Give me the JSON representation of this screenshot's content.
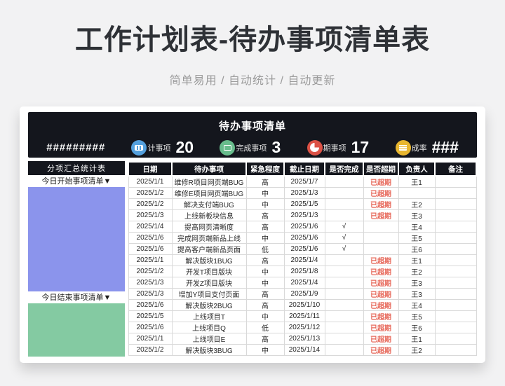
{
  "page": {
    "title": "工作计划表-待办事项清单表",
    "subtitle": "简单易用 / 自动统计 / 自动更新"
  },
  "sheet": {
    "topbar": {
      "title": "待办事项清单",
      "date_placeholder": "#########",
      "stats": [
        {
          "icon": "abacus-icon",
          "color": "#54a0dd",
          "label": "计事项",
          "value": "20"
        },
        {
          "icon": "monitor-icon",
          "color": "#68bc8c",
          "label": "完成事项",
          "value": "3"
        },
        {
          "icon": "pie-clock-icon",
          "color": "#dc5246",
          "label": "期事项",
          "value": "17"
        },
        {
          "icon": "calendar-icon",
          "color": "#e8b62f",
          "label": "成率",
          "value": "###"
        }
      ]
    },
    "sidebar": {
      "title": "分项汇总统计表",
      "sections": [
        {
          "label": "今日开始事项清单▼",
          "panel_color": "#8b94ec"
        },
        {
          "label": "今日结束事项清单▼",
          "panel_color": "#84caa2"
        }
      ]
    },
    "table": {
      "columns": [
        "日期",
        "待办事项",
        "紧急程度",
        "截止日期",
        "是否完成",
        "是否超期",
        "负责人",
        "备注"
      ],
      "rows": [
        [
          "2025/1/1",
          "维修R项目网页端BUG",
          "高",
          "2025/1/7",
          "",
          "已超期",
          "王1",
          ""
        ],
        [
          "2025/1/2",
          "维修E项目网页端BUG",
          "中",
          "2025/1/3",
          "",
          "已超期",
          "",
          ""
        ],
        [
          "2025/1/2",
          "解决支付端BUG",
          "中",
          "2025/1/5",
          "",
          "已超期",
          "王2",
          ""
        ],
        [
          "2025/1/3",
          "上线新板块信息",
          "高",
          "2025/1/3",
          "",
          "已超期",
          "王3",
          ""
        ],
        [
          "2025/1/4",
          "提高网页清晰度",
          "高",
          "2025/1/6",
          "√",
          "",
          "王4",
          ""
        ],
        [
          "2025/1/6",
          "完成网页端新品上线",
          "中",
          "2025/1/6",
          "√",
          "",
          "王5",
          ""
        ],
        [
          "2025/1/6",
          "提高客户端新品页面",
          "低",
          "2025/1/6",
          "√",
          "",
          "王6",
          ""
        ],
        [
          "2025/1/1",
          "解决版块1BUG",
          "高",
          "2025/1/4",
          "",
          "已超期",
          "王1",
          ""
        ],
        [
          "2025/1/2",
          "开发T项目版块",
          "中",
          "2025/1/8",
          "",
          "已超期",
          "王2",
          ""
        ],
        [
          "2025/1/3",
          "开发Z项目版块",
          "中",
          "2025/1/4",
          "",
          "已超期",
          "王3",
          ""
        ],
        [
          "2025/1/3",
          "增加Y项目支付页面",
          "高",
          "2025/1/9",
          "",
          "已超期",
          "王3",
          ""
        ],
        [
          "2025/1/6",
          "解决版块2BUG",
          "高",
          "2025/1/10",
          "",
          "已超期",
          "王4",
          ""
        ],
        [
          "2025/1/5",
          "上线项目T",
          "中",
          "2025/1/11",
          "",
          "已超期",
          "王5",
          ""
        ],
        [
          "2025/1/6",
          "上线项目Q",
          "低",
          "2025/1/12",
          "",
          "已超期",
          "王6",
          ""
        ],
        [
          "2025/1/1",
          "上线项目E",
          "高",
          "2025/1/13",
          "",
          "已超期",
          "王1",
          ""
        ],
        [
          "2025/1/2",
          "解决版块3BUG",
          "中",
          "2025/1/14",
          "",
          "已超期",
          "王2",
          ""
        ]
      ]
    }
  },
  "colors": {
    "page_bg": "#f2f2f3",
    "dark_bar": "#14161d",
    "overdue_red": "#e7685a",
    "panel_blue": "#8b94ec",
    "panel_green": "#84caa2"
  }
}
